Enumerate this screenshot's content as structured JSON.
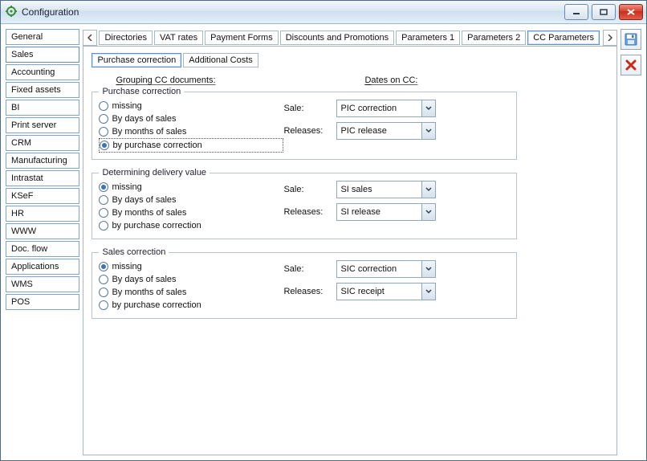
{
  "window": {
    "title": "Configuration"
  },
  "sidebar": {
    "items": [
      {
        "label": "General"
      },
      {
        "label": "Sales",
        "active": true
      },
      {
        "label": "Accounting"
      },
      {
        "label": "Fixed assets"
      },
      {
        "label": "BI"
      },
      {
        "label": "Print server"
      },
      {
        "label": "CRM"
      },
      {
        "label": "Manufacturing"
      },
      {
        "label": "Intrastat"
      },
      {
        "label": "KSeF"
      },
      {
        "label": "HR"
      },
      {
        "label": "WWW"
      },
      {
        "label": "Doc. flow"
      },
      {
        "label": "Applications"
      },
      {
        "label": "WMS"
      },
      {
        "label": "POS"
      }
    ]
  },
  "tabs": {
    "items": [
      {
        "label": "Directories"
      },
      {
        "label": "VAT rates"
      },
      {
        "label": "Payment Forms"
      },
      {
        "label": "Discounts and Promotions"
      },
      {
        "label": "Parameters 1"
      },
      {
        "label": "Parameters 2"
      },
      {
        "label": "CC Parameters",
        "active": true
      }
    ]
  },
  "subtabs": {
    "items": [
      {
        "label": "Purchase correction",
        "active": true
      },
      {
        "label": "Additional Costs"
      }
    ]
  },
  "headers": {
    "grouping_pre": "G",
    "grouping_rest": "rouping CC documents:",
    "dates_pre": "D",
    "dates_rest": "ates on CC:"
  },
  "radio_opts": {
    "r0": "missing",
    "r1": "By days of sales",
    "r2": "By months of sales",
    "r3": "by purchase correction"
  },
  "labels": {
    "sale": "Sale:",
    "releases": "Releases:"
  },
  "groups": [
    {
      "legend": "Purchase correction",
      "selected_radio": 3,
      "sel_focus": true,
      "sale": "PIC correction",
      "releases": "PIC release"
    },
    {
      "legend": "Determining delivery value",
      "selected_radio": 0,
      "sale": "SI sales",
      "releases": "SI release"
    },
    {
      "legend": "Sales correction",
      "selected_radio": 0,
      "sale": "SIC correction",
      "releases": "SIC receipt"
    }
  ]
}
